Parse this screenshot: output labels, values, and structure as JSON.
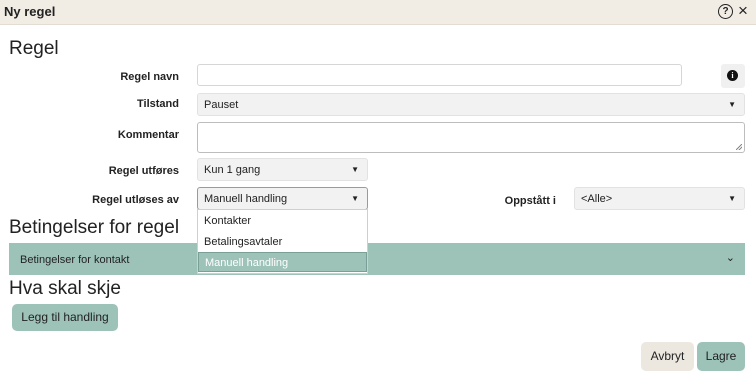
{
  "window": {
    "title": "Ny regel",
    "help_icon_glyph": "?",
    "close_icon_glyph": "×"
  },
  "section_regel": {
    "heading": "Regel",
    "name_label": "Regel navn",
    "name_value": "",
    "info_icon_glyph": "i",
    "state_label": "Tilstand",
    "state_value": "Pauset",
    "comment_label": "Kommentar",
    "comment_value": "",
    "executes_label": "Regel utføres",
    "executes_value": "Kun 1 gang",
    "trigger_label": "Regel utløses av",
    "trigger_value": "Manuell handling",
    "trigger_options": [
      "Kontakter",
      "Betalingsavtaler",
      "Manuell handling"
    ],
    "trigger_selected": "Manuell handling",
    "occurred_label": "Oppstått i",
    "occurred_value": "<Alle>"
  },
  "section_conditions": {
    "heading": "Betingelser for regel",
    "accordion_label": "Betingelser for kontakt"
  },
  "section_actions": {
    "heading": "Hva skal skje",
    "add_action_label": "Legg til handling"
  },
  "footer": {
    "cancel_label": "Avbryt",
    "save_label": "Lagre"
  },
  "colors": {
    "accent": "#9dc3b9",
    "titlebar": "#f1ece4",
    "cancel_button": "#ece7df"
  },
  "icons": {
    "caret": "▼",
    "chevron": "⌄"
  }
}
